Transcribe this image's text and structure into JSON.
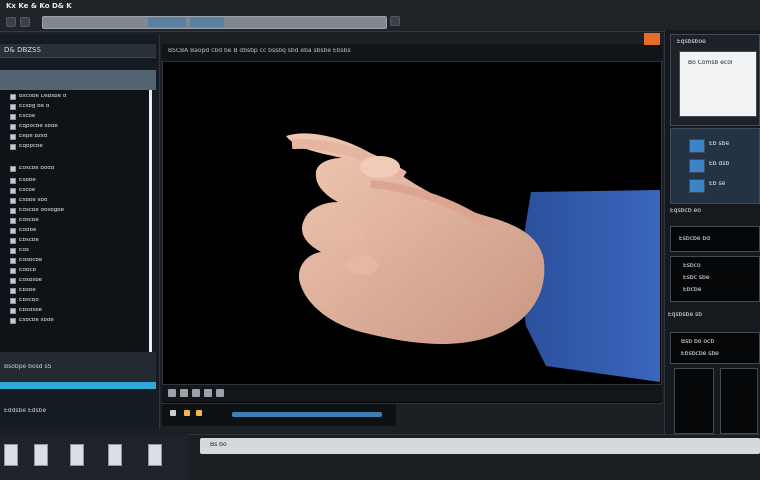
{
  "window": {
    "title": "Kx Ke & Ko D& K"
  },
  "toolbar": {
    "address_value": "",
    "tab1": "",
    "tab2": ""
  },
  "sidebar": {
    "header": "D& DBZSS",
    "section_title": "",
    "items": [
      {
        "label": "Bscobe Dsbsbe d"
      },
      {
        "label": "Ecsbg be d"
      },
      {
        "label": "Escbe"
      },
      {
        "label": "Eqpocbe sbde"
      },
      {
        "label": "Eepe bzsd"
      },
      {
        "label": "Eqbpcbe"
      },
      {
        "label": "Eoscbe bodd"
      },
      {
        "label": "Esbbe"
      },
      {
        "label": "Escbe"
      },
      {
        "label": "Esbbe sbd"
      },
      {
        "label": "Edscbe dosbgbe"
      },
      {
        "label": "Edscbe"
      },
      {
        "label": "Eddbe"
      },
      {
        "label": "Ebscbe"
      },
      {
        "label": "Eds"
      },
      {
        "label": "Edsbcbe"
      },
      {
        "label": "Edbcb"
      },
      {
        "label": "Edsbsbe"
      },
      {
        "label": "Ebsbe"
      },
      {
        "label": "Ebscbo"
      },
      {
        "label": "Ebsdsbe"
      },
      {
        "label": "Esbcbe sbde"
      }
    ],
    "footer_text": "Bsobpe bosd sS",
    "bottom_label": "Eddsbe   Edsbe"
  },
  "center": {
    "header_text": "BSCBA  Baopd cbd be  B dbsbp cc bssbq sbd  eba sbsbe Ebsbs",
    "controls_label": "",
    "progress_label": ""
  },
  "right": {
    "panel1_header": "Eqsbsboe",
    "panel1_text": "Bo Comsb ecol",
    "panel2_items": [
      "Eb sbe",
      "Eb dsb",
      "Eb se"
    ],
    "panel3_label": "Eqsbcb eo",
    "panel4_label": "Esbcbe bd",
    "panel5_lines": [
      "Esbco",
      "Esbc sbe",
      "Ebcbe"
    ],
    "panel6_label": "Eqsbsbe sb",
    "panel7_lines": [
      "Bsb bo ocb",
      "Ebsbcbe sbe"
    ]
  },
  "bottom": {
    "bar_text": "Bs bo"
  }
}
